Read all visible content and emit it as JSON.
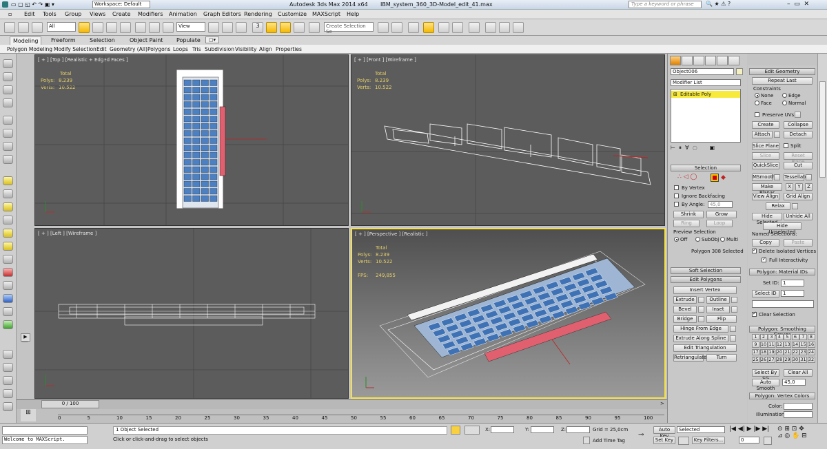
{
  "titlebar": {
    "workspace": "Workspace: Default",
    "title": "Autodesk 3ds Max  2014 x64",
    "file": "IBM_system_360_3D-Model_edit_41.max",
    "search_placeholder": "Type a keyword or phrase"
  },
  "menu": [
    "Edit",
    "Tools",
    "Group",
    "Views",
    "Create",
    "Modifiers",
    "Animation",
    "Graph Editors",
    "Rendering",
    "Customize",
    "MAXScript",
    "Help"
  ],
  "toolbar": {
    "filter": "All",
    "viewmode": "View",
    "selection_set": "Create Selection Se",
    "snap_label": "3"
  },
  "ribbon": {
    "tabs": [
      "Modeling",
      "Freeform",
      "Selection",
      "Object Paint",
      "Populate"
    ],
    "sub": [
      "Polygon Modeling",
      "Modify Selection",
      "Edit",
      "Geometry (All)",
      "Polygons",
      "Loops",
      "Tris",
      "Subdivision",
      "Visibility",
      "Align",
      "Properties"
    ]
  },
  "viewports": {
    "top": {
      "label": "[ + ] [Top ] [Realistic + Edged Faces ]",
      "total": "Total",
      "polys_label": "Polys:",
      "polys": "8.239",
      "verts_label": "Verts:",
      "verts": "10.522"
    },
    "front": {
      "label": "[ + ] [Front ] [Wireframe ]",
      "total": "Total",
      "polys_label": "Polys:",
      "polys": "8.239",
      "verts_label": "Verts:",
      "verts": "10.522"
    },
    "left": {
      "label": "[ + ] [Left ] [Wireframe ]"
    },
    "persp": {
      "label": "[ + ] [Perspective ] [Realistic ]",
      "total": "Total",
      "polys_label": "Polys:",
      "polys": "8.239",
      "verts_label": "Verts:",
      "verts": "10.522",
      "fps_label": "FPS:",
      "fps": "249,855"
    }
  },
  "cmd": {
    "object_name": "Object006",
    "modifier_list": "Modifier List",
    "stack_item": "Editable Poly",
    "selection_title": "Selection",
    "by_vertex": "By Vertex",
    "ignore_backfacing": "Ignore Backfacing",
    "by_angle": "By Angle:",
    "angle": "45,0",
    "shrink": "Shrink",
    "grow": "Grow",
    "ring": "Ring",
    "loop": "Loop",
    "preview_selection": "Preview Selection",
    "off": "Off",
    "subobj": "SubObj",
    "multi": "Multi",
    "selected": "Polygon 308 Selected",
    "soft_selection": "Soft Selection",
    "edit_polygons": "Edit Polygons",
    "insert_vertex": "Insert Vertex",
    "extrude": "Extrude",
    "outline": "Outline",
    "bevel": "Bevel",
    "inset": "Inset",
    "bridge": "Bridge",
    "flip": "Flip",
    "hinge": "Hinge From Edge",
    "extrude_spline": "Extrude Along Spline",
    "edit_tri": "Edit Triangulation",
    "retriangulate": "Retriangulate",
    "turn": "Turn"
  },
  "geom": {
    "edit_geometry": "Edit Geometry",
    "repeat_last": "Repeat Last",
    "constraints": "Constraints",
    "none": "None",
    "edge": "Edge",
    "face": "Face",
    "normal": "Normal",
    "preserve_uvs": "Preserve UVs",
    "create": "Create",
    "collapse": "Collapse",
    "attach": "Attach",
    "detach": "Detach",
    "slice_plane": "Slice Plane",
    "split": "Split",
    "slice": "Slice",
    "reset_plane": "Reset Plane",
    "quickslice": "QuickSlice",
    "cut": "Cut",
    "msmooth": "MSmooth",
    "tessellate": "Tessellate",
    "make_planar": "Make Planar",
    "x": "X",
    "y": "Y",
    "z": "Z",
    "view_align": "View Align",
    "grid_align": "Grid Align",
    "relax": "Relax",
    "hide_selected": "Hide Selected",
    "unhide_all": "Unhide All",
    "hide_unselected": "Hide Unselected",
    "named_selections": "Named Selections:",
    "copy": "Copy",
    "paste": "Paste",
    "delete_isolated": "Delete Isolated Vertices",
    "full_interactivity": "Full Interactivity",
    "material_ids": "Polygon: Material IDs",
    "set_id": "Set ID:",
    "set_id_val": "1",
    "select_id": "Select ID",
    "select_id_val": "1",
    "clear_selection": "Clear Selection",
    "smoothing_groups": "Polygon: Smoothing Groups",
    "sg": [
      "1",
      "2",
      "3",
      "4",
      "5",
      "6",
      "7",
      "8",
      "9",
      "10",
      "11",
      "12",
      "13",
      "14",
      "15",
      "16",
      "17",
      "18",
      "19",
      "20",
      "21",
      "22",
      "23",
      "24",
      "25",
      "26",
      "27",
      "28",
      "29",
      "30",
      "31",
      "32"
    ],
    "select_by_sg": "Select By SG",
    "clear_all": "Clear All",
    "auto_smooth": "Auto Smooth",
    "auto_smooth_val": "45,0",
    "vertex_colors": "Polygon: Vertex Colors",
    "color": "Color:",
    "illumination": "Illumination:"
  },
  "timeline": {
    "frame": "0 / 100",
    "ticks": [
      "0",
      "5",
      "10",
      "15",
      "20",
      "25",
      "30",
      "35",
      "40",
      "45",
      "50",
      "55",
      "60",
      "65",
      "70",
      "75",
      "80",
      "85",
      "90",
      "95",
      "100"
    ]
  },
  "status": {
    "listener": "Welcome to MAXScript.",
    "objects": "1 Object Selected",
    "prompt": "Click or click-and-drag to select objects",
    "x": "X:",
    "y": "Y:",
    "z": "Z:",
    "grid": "Grid = 25,0cm",
    "add_time_tag": "Add Time Tag",
    "auto_key": "Auto Key",
    "set_key": "Set Key",
    "selected": "Selected",
    "key_filters": "Key Filters...",
    "frame": "0"
  }
}
